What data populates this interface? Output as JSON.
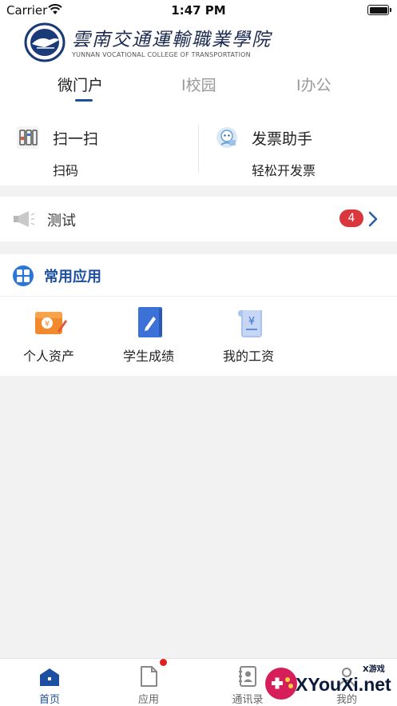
{
  "status_bar": {
    "carrier": "Carrier",
    "time": "1:47 PM"
  },
  "header": {
    "logo_cn": "雲南交通運輸職業學院",
    "logo_en": "YUNNAN VOCATIONAL COLLEGE OF TRANSPORTATION"
  },
  "tabs": [
    {
      "label": "微门户",
      "active": true
    },
    {
      "label": "I校园",
      "active": false
    },
    {
      "label": "I办公",
      "active": false
    }
  ],
  "quick_actions": [
    {
      "title": "扫一扫",
      "subtitle": "扫码",
      "icon": "scan-icon"
    },
    {
      "title": "发票助手",
      "subtitle": "轻松开发票",
      "icon": "invoice-helper-icon"
    }
  ],
  "notice": {
    "title": "测试",
    "count": "4",
    "icon": "megaphone-icon"
  },
  "apps_section": {
    "title": "常用应用",
    "items": [
      {
        "label": "个人资产",
        "icon": "wallet-icon"
      },
      {
        "label": "学生成绩",
        "icon": "notebook-pen-icon"
      },
      {
        "label": "我的工资",
        "icon": "salary-scroll-icon"
      }
    ]
  },
  "tab_bar": [
    {
      "label": "首页",
      "icon": "home-icon",
      "active": true
    },
    {
      "label": "应用",
      "icon": "document-icon",
      "active": false,
      "has_dot": true
    },
    {
      "label": "通讯录",
      "icon": "contacts-icon",
      "active": false
    },
    {
      "label": "我的",
      "icon": "profile-icon",
      "active": false
    }
  ],
  "watermark": {
    "main": "XYouXi.net",
    "small": "X游戏"
  },
  "colors": {
    "accent": "#1d4fa1",
    "badge": "#d9363e",
    "app_orange": "#f08a2c",
    "app_blue": "#3c72d8",
    "background": "#f2f2f2"
  }
}
